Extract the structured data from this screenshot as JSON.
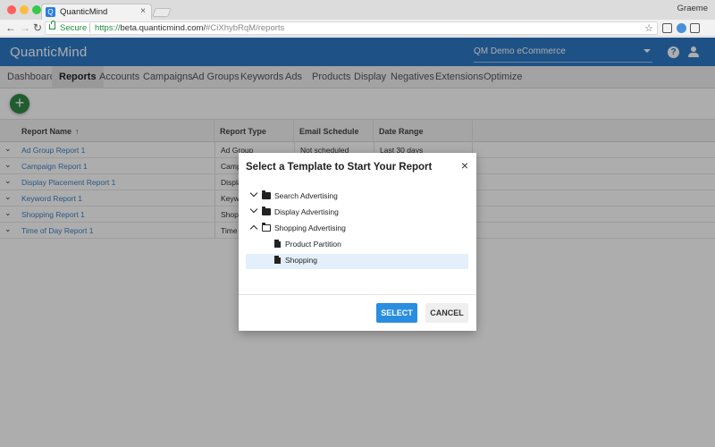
{
  "browser": {
    "tab_title": "QuanticMind",
    "tab_close": "×",
    "user": "Graeme",
    "secure_label": "Secure",
    "url_https": "https://",
    "url_host": "beta.quanticmind.com/",
    "url_fragment": "#CiXhybRqM/reports"
  },
  "header": {
    "logo": "QuanticMind",
    "account": "QM Demo eCommerce",
    "help": "?"
  },
  "nav": {
    "items": [
      "Dashboards",
      "Reports",
      "Accounts",
      "Campaigns",
      "Ad Groups",
      "Keywords",
      "Ads",
      "Products",
      "Display",
      "Negatives",
      "Extensions",
      "Optimize"
    ],
    "active": "Reports"
  },
  "fab": {
    "label": "+"
  },
  "table": {
    "columns": [
      "Report Name",
      "Report Type",
      "Email Schedule",
      "Date Range"
    ],
    "sort_indicator": "↑",
    "rows": [
      {
        "name": "Ad Group Report 1",
        "type": "Ad Group",
        "schedule": "Not scheduled",
        "range": "Last 30 days"
      },
      {
        "name": "Campaign Report 1",
        "type": "Campa",
        "schedule": "",
        "range": ""
      },
      {
        "name": "Display Placement Report 1",
        "type": "Displa",
        "schedule": "",
        "range": ""
      },
      {
        "name": "Keyword Report 1",
        "type": "Keywo",
        "schedule": "",
        "range": ""
      },
      {
        "name": "Shopping Report 1",
        "type": "Shopp",
        "schedule": "",
        "range": ""
      },
      {
        "name": "Time of Day Report 1",
        "type": "Time o",
        "schedule": "",
        "range": ""
      }
    ]
  },
  "dialog": {
    "title": "Select a Template to Start Your Report",
    "close": "×",
    "tree": [
      {
        "label": "Search Advertising",
        "kind": "folder",
        "expanded": false
      },
      {
        "label": "Display Advertising",
        "kind": "folder",
        "expanded": false
      },
      {
        "label": "Shopping Advertising",
        "kind": "folder",
        "expanded": true
      },
      {
        "label": "Product Partition",
        "kind": "file",
        "selected": false
      },
      {
        "label": "Shopping",
        "kind": "file",
        "selected": true
      }
    ],
    "select_label": "SELECT",
    "cancel_label": "CANCEL"
  }
}
